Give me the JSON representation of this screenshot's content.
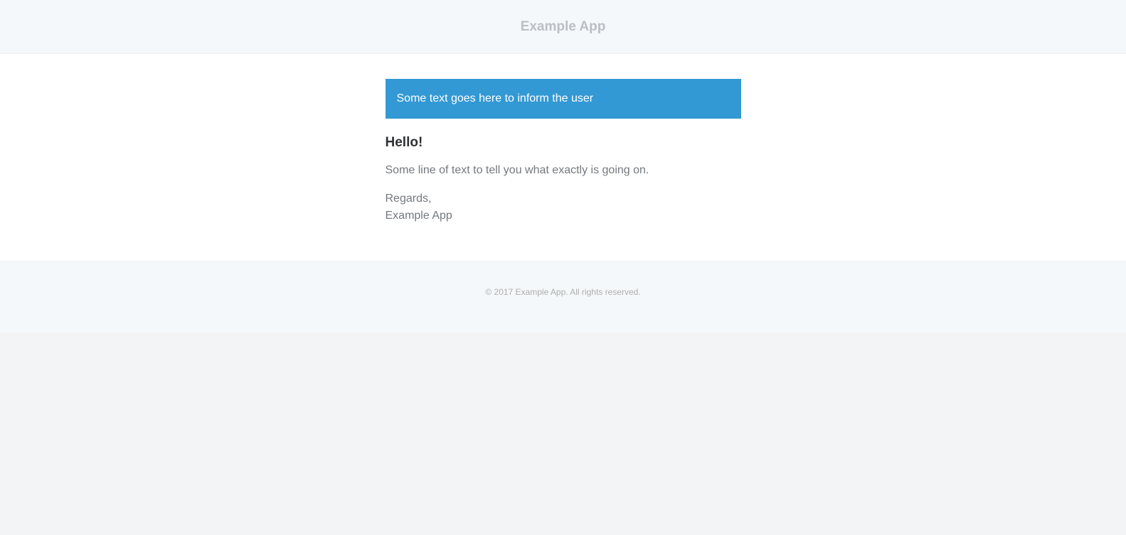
{
  "header": {
    "app_name": "Example App"
  },
  "panel": {
    "text": "Some text goes here to inform the user",
    "color": "#3399d4"
  },
  "message": {
    "greeting": "Hello!",
    "intro_line": "Some line of text to tell you what exactly is going on.",
    "salutation": "Regards,",
    "signature": "Example App"
  },
  "footer": {
    "copyright": "© 2017 Example App. All rights reserved."
  }
}
